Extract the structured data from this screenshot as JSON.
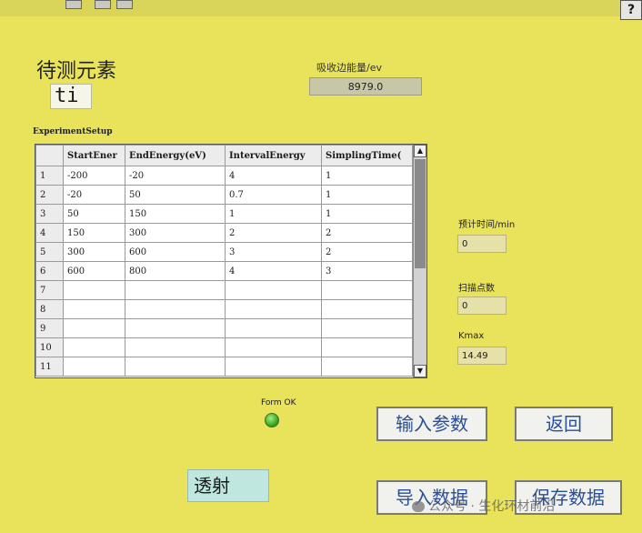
{
  "window": {
    "help_label": "?"
  },
  "header": {
    "title": "待测元素",
    "element_value": "ti",
    "absorption_edge_label": "吸收边能量/ev",
    "absorption_edge_value": "8979.0"
  },
  "experiment_setup": {
    "label": "ExperimentSetup",
    "columns": [
      "",
      "StartEner",
      "EndEnergy(eV)",
      "IntervalEnergy",
      "SimplingTime("
    ],
    "rows": [
      [
        "1",
        "-200",
        "-20",
        "4",
        "1"
      ],
      [
        "2",
        "-20",
        "50",
        "0.7",
        "1"
      ],
      [
        "3",
        "50",
        "150",
        "1",
        "1"
      ],
      [
        "4",
        "150",
        "300",
        "2",
        "2"
      ],
      [
        "5",
        "300",
        "600",
        "3",
        "2"
      ],
      [
        "6",
        "600",
        "800",
        "4",
        "3"
      ],
      [
        "7",
        "",
        "",
        "",
        ""
      ],
      [
        "8",
        "",
        "",
        "",
        ""
      ],
      [
        "9",
        "",
        "",
        "",
        ""
      ],
      [
        "10",
        "",
        "",
        "",
        ""
      ],
      [
        "11",
        "",
        "",
        "",
        ""
      ]
    ]
  },
  "side_panel": {
    "est_time_label": "预计时间/min",
    "est_time_value": "0",
    "scan_points_label": "扫描点数",
    "scan_points_value": "0",
    "kmax_label": "Kmax",
    "kmax_value": "14.49"
  },
  "status": {
    "form_ok_label": "Form OK",
    "led_color": "#3dbb1f"
  },
  "buttons": {
    "input_params": "输入参数",
    "back": "返回",
    "import_data": "导入数据",
    "save_data": "保存数据"
  },
  "mode": {
    "value": "透射"
  },
  "watermark": {
    "text": "公众号 · 生化环材前沿"
  }
}
